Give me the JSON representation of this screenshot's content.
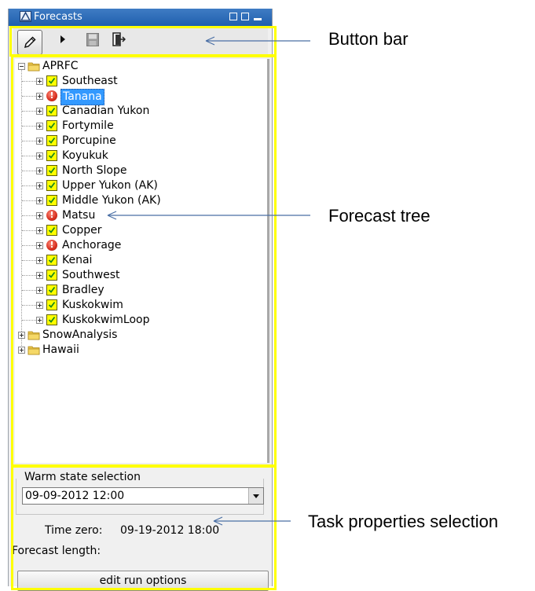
{
  "window": {
    "title": "Forecasts"
  },
  "toolbar": {
    "buttons": [
      {
        "icon": "pencil-icon"
      },
      {
        "icon": "play-icon"
      },
      {
        "icon": "floppy-disk-icon"
      },
      {
        "icon": "exit-door-icon"
      }
    ]
  },
  "tree": {
    "root": {
      "label": "APRFC",
      "expanded": true
    },
    "children": [
      {
        "label": "Southeast",
        "status": "ok"
      },
      {
        "label": "Tanana",
        "status": "error",
        "selected": true
      },
      {
        "label": "Canadian Yukon",
        "status": "ok"
      },
      {
        "label": "Fortymile",
        "status": "ok"
      },
      {
        "label": "Porcupine",
        "status": "ok"
      },
      {
        "label": "Koyukuk",
        "status": "ok"
      },
      {
        "label": "North Slope",
        "status": "ok"
      },
      {
        "label": "Upper Yukon (AK)",
        "status": "ok"
      },
      {
        "label": "Middle Yukon (AK)",
        "status": "ok"
      },
      {
        "label": "Matsu",
        "status": "error"
      },
      {
        "label": "Copper",
        "status": "ok"
      },
      {
        "label": "Anchorage",
        "status": "error"
      },
      {
        "label": "Kenai",
        "status": "ok"
      },
      {
        "label": "Southwest",
        "status": "ok"
      },
      {
        "label": "Bradley",
        "status": "ok"
      },
      {
        "label": "Kuskokwim",
        "status": "ok"
      },
      {
        "label": "KuskokwimLoop",
        "status": "ok"
      }
    ],
    "siblings": [
      {
        "label": "SnowAnalysis"
      },
      {
        "label": "Hawaii"
      }
    ]
  },
  "properties": {
    "warm_state_label": "Warm state selection",
    "warm_state_value": "09-09-2012 12:00",
    "time_zero_label": "Time zero:",
    "time_zero_value": "09-19-2012 18:00",
    "forecast_length_label": "Forecast length:",
    "edit_run_label": "edit run options"
  },
  "callouts": {
    "button_bar": "Button bar",
    "forecast_tree": "Forecast tree",
    "task_properties": "Task properties selection"
  },
  "colors": {
    "highlight": "#ffff00",
    "arrow": "#4a6fa5",
    "selection": "#3399ff",
    "check_bg": "#ffff00",
    "check_mark": "#1a8a1a",
    "error": "#d62f1f"
  }
}
